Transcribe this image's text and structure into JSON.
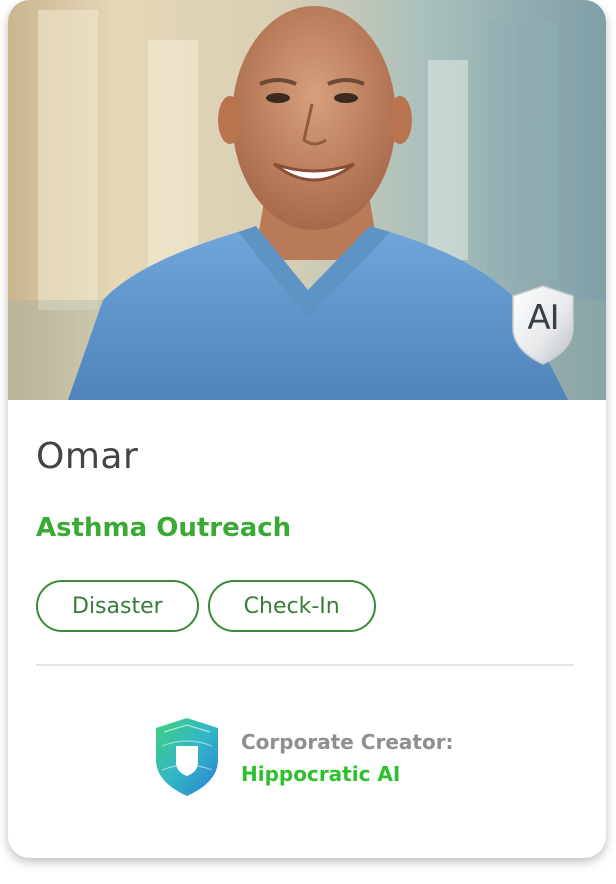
{
  "profile": {
    "name": "Omar",
    "program": "Asthma Outreach",
    "badge": "AI",
    "photo_icon": "portrait-photo"
  },
  "tags": [
    {
      "label": "Disaster"
    },
    {
      "label": "Check-In"
    }
  ],
  "creator": {
    "label": "Corporate Creator:",
    "name": "Hippocratic AI",
    "logo_icon": "shield-logo-icon"
  },
  "colors": {
    "program_green": "#3aaa35",
    "tag_border": "#3a8a3a",
    "creator_green": "#2ec12e",
    "scrubs_blue": "#5d93c9"
  }
}
